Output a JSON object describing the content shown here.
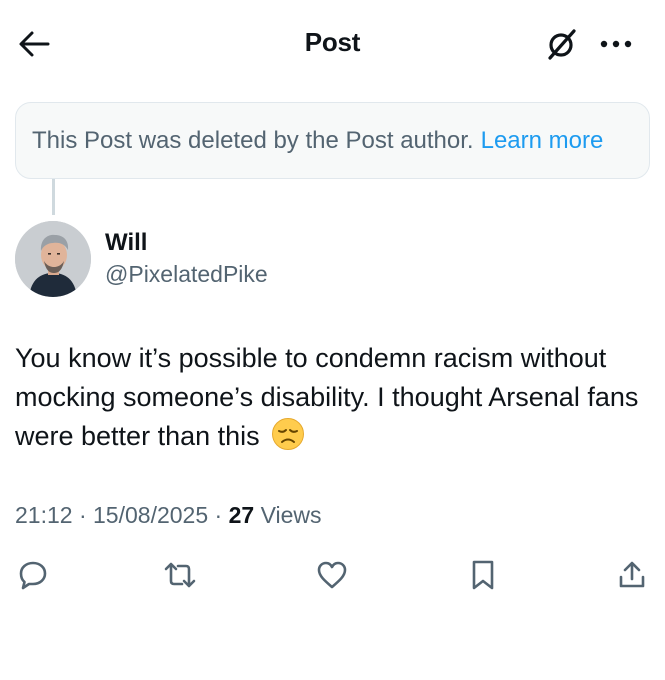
{
  "header": {
    "title": "Post",
    "back_icon": "arrow-left-icon",
    "grok_icon": "grok-icon",
    "more_icon": "more-dots-icon"
  },
  "notice": {
    "text": "This Post was deleted by the Post author.",
    "link": "Learn more"
  },
  "author": {
    "name": "Will",
    "handle": "@PixelatedPike"
  },
  "post": {
    "text": "You know it’s possible to condemn racism without mocking someone’s disability. I thought Arsenal fans were better than this",
    "emoji": "disappointed-face"
  },
  "meta": {
    "time": "21:12",
    "separator": " · ",
    "date": "15/08/2025",
    "views_count": "27",
    "views_label": " Views"
  },
  "actions": [
    "reply-icon",
    "repost-icon",
    "like-icon",
    "bookmark-icon",
    "share-icon"
  ],
  "colors": {
    "text": "#0f1419",
    "secondary": "#536471",
    "link": "#1d9bf0",
    "notice_bg": "#f7f9f9"
  }
}
